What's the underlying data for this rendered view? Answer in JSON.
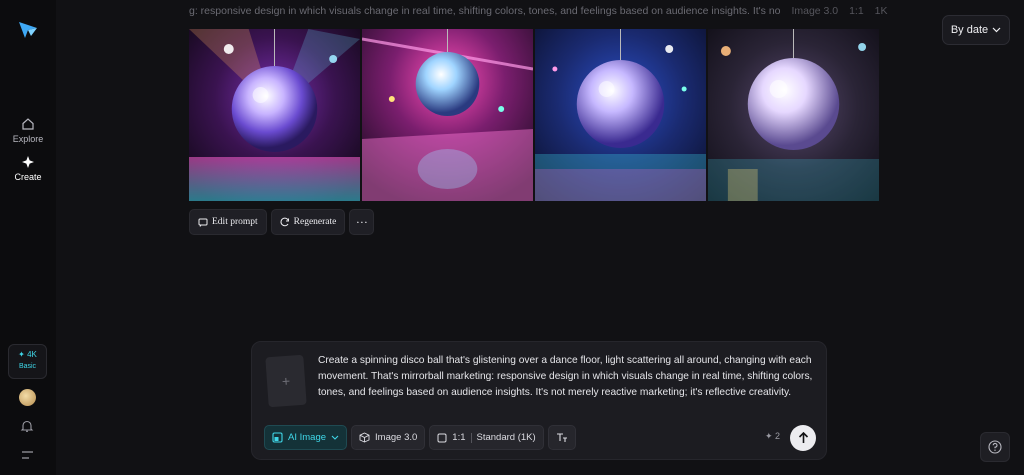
{
  "sidebar": {
    "logo_icon": "star-arrow-logo",
    "items": [
      {
        "label": "Explore",
        "icon": "home-icon"
      },
      {
        "label": "Create",
        "icon": "sparkle-icon"
      }
    ],
    "credits": {
      "amount": "✦ 4K",
      "plan": "Basic"
    },
    "bottom_icons": [
      "avatar",
      "bell-icon",
      "menu-icon"
    ]
  },
  "header": {
    "prompt_snippet": "g: responsive design in which visuals change in real time, shifting colors, tones, and feelings based on audience insights. It's no",
    "model": "Image 3.0",
    "ratio": "1:1",
    "resolution": "1K",
    "sort_label": "By date"
  },
  "gallery": {
    "images": [
      {
        "alt": "disco ball 1"
      },
      {
        "alt": "disco ball 2"
      },
      {
        "alt": "disco ball 3"
      },
      {
        "alt": "disco ball 4"
      }
    ]
  },
  "actions": {
    "edit_label": "Edit prompt",
    "regenerate_label": "Regenerate",
    "more_label": "···"
  },
  "prompt": {
    "text": "Create a spinning disco ball that's glistening over a dance floor, light scattering all around, changing with each movement. That's mirrorball marketing: responsive design in which visuals change in real time, shifting colors, tones, and feelings based on audience insights. It's not merely reactive marketing; it's reflective creativity.",
    "add_symbol": "+",
    "toolbar": {
      "type_label": "AI Image",
      "model_label": "Image 3.0",
      "ratio_label": "1:1",
      "quality_label": "Standard (1K)",
      "text_icon": "text-format-icon"
    },
    "cost": "✦ 2"
  },
  "colors": {
    "accent": "#3fd7e8",
    "background": "#111114",
    "panel": "#1c1c21"
  }
}
